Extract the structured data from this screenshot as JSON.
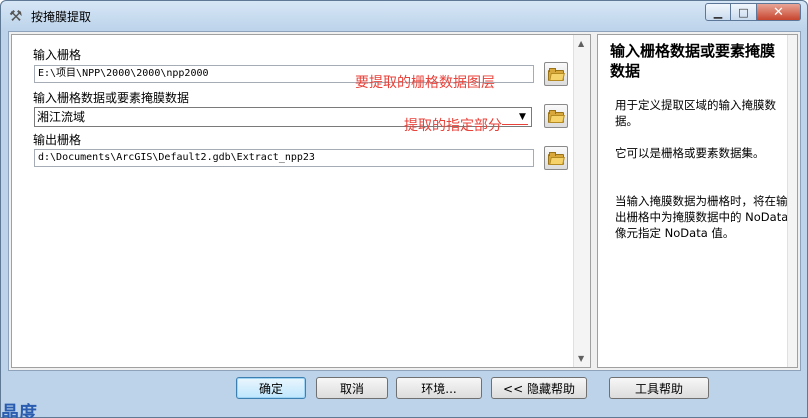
{
  "window": {
    "title": "按掩膜提取",
    "title_icon": "hammer-icon"
  },
  "caption": {
    "minimize": "▭",
    "maximize": "□",
    "close": "✕"
  },
  "form": {
    "input_raster": {
      "label": "输入栅格",
      "value": "E:\\项目\\NPP\\2000\\2000\\npp2000"
    },
    "mask": {
      "label": "输入栅格数据或要素掩膜数据",
      "value": "湘江流域"
    },
    "output_raster": {
      "label": "输出栅格",
      "value": "d:\\Documents\\ArcGIS\\Default2.gdb\\Extract_npp23"
    }
  },
  "annotations": {
    "raster_note": "要提取的栅格数据图层",
    "mask_note": "提取的指定部分"
  },
  "help": {
    "title": "输入栅格数据或要素掩膜数据",
    "para1": "用于定义提取区域的输入掩膜数据。",
    "para2": "它可以是栅格或要素数据集。",
    "para3": "当输入掩膜数据为栅格时，将在输出栅格中为掩膜数据中的 NoData 像元指定 NoData 值。"
  },
  "buttons": {
    "ok": "确定",
    "cancel": "取消",
    "environments": "环境...",
    "hide_help": "<< 隐藏帮助",
    "tool_help": "工具帮助"
  },
  "watermark": "晶度"
}
